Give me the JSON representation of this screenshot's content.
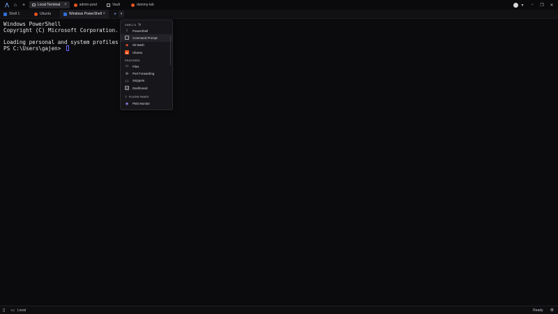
{
  "titlebar": {
    "window_tabs": [
      {
        "label": "Local Terminal",
        "active": true
      },
      {
        "label": "admin-prod",
        "active": false
      },
      {
        "label": "Vault",
        "active": false
      },
      {
        "label": "dummy-lab",
        "active": false
      }
    ]
  },
  "tabbar": {
    "tabs": [
      {
        "label": "Shell 1"
      },
      {
        "label": "Ubuntu"
      },
      {
        "label": "Windows PowerShell"
      }
    ]
  },
  "terminal": {
    "lines": [
      "Windows PowerShell",
      "Copyright (C) Microsoft Corporation. All righ",
      "",
      "Loading personal and system profiles took 256",
      "PS C:\\Users\\gajen> "
    ]
  },
  "menu": {
    "shells_header": "SHELLS",
    "shells": [
      "PowerShell",
      "Command Prompt",
      "Git Bash",
      "Ubuntu"
    ],
    "features_header": "FEATURES",
    "features": [
      "Files",
      "Port Forwarding",
      "Snippets",
      "Dashboard"
    ],
    "plugin_header": "PLUGIN PANES",
    "plugins": [
      "PM2 Monitor"
    ]
  },
  "statusbar": {
    "connection": "Local",
    "status": "Ready"
  },
  "colors": {
    "accent": "#7aa7ff",
    "ubuntu": "#e95420",
    "gitbash": "#f05032",
    "powershell_tab": "#2f6fd6"
  }
}
